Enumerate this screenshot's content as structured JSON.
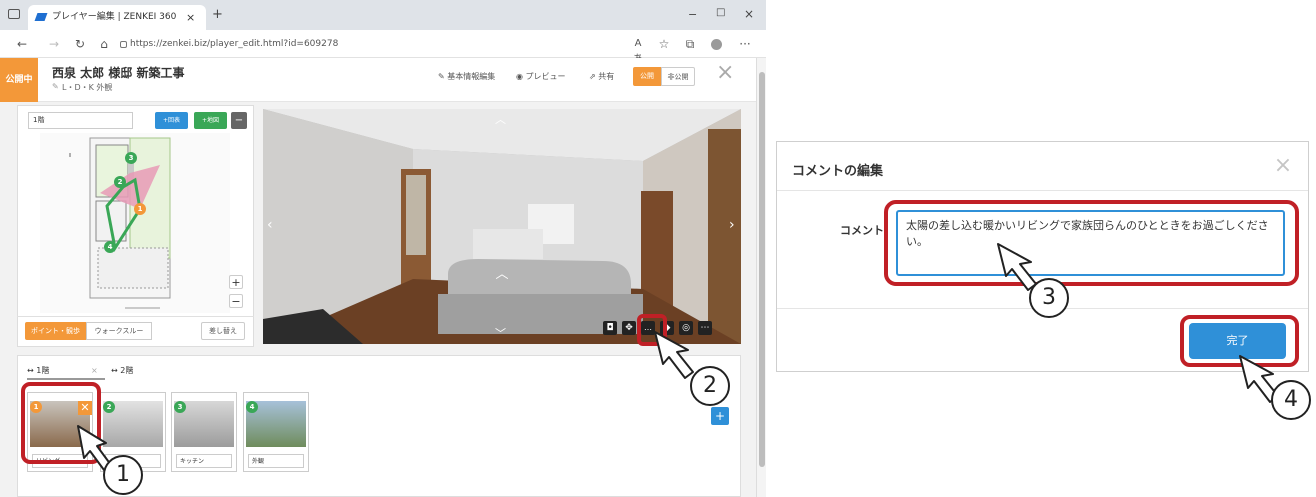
{
  "browser": {
    "tab_title": "プレイヤー編集 | ZENKEI 360",
    "tab_close": "×",
    "new_tab": "+",
    "url": "https://zenkei.biz/player_edit.html?id=609278",
    "win_controls": [
      "−",
      "□",
      "×"
    ]
  },
  "header": {
    "status_badge": "公開中",
    "title": "西泉 太郎 様邸 新築工事",
    "subtitle": "L・D・K 外観",
    "links": [
      "基本情報編集",
      "プレビュー",
      "共有"
    ],
    "publish_on": "公開",
    "publish_off": "非公開",
    "close": "×"
  },
  "map": {
    "floor_value": "1階",
    "add_floorplan": "+回表",
    "add_map": "+地図",
    "remove": "−",
    "zoom_in": "+",
    "zoom_out": "−",
    "mode_point": "ポイント・観歩",
    "mode_walk": "ウォークスルー",
    "replace": "差し替え",
    "points": [
      "1",
      "2",
      "3",
      "4"
    ]
  },
  "floor_tabs": [
    "1階",
    "2階"
  ],
  "scenes": [
    {
      "num": "1",
      "name": "リビング",
      "color": "#f39839"
    },
    {
      "num": "2",
      "name": "",
      "color": "#3aa757"
    },
    {
      "num": "3",
      "name": "キッチン",
      "color": "#3aa757"
    },
    {
      "num": "4",
      "name": "外観",
      "color": "#3aa757"
    }
  ],
  "add_scene": "+",
  "modal": {
    "title": "コメントの編集",
    "close": "×",
    "label": "コメント",
    "text": "太陽の差し込む暖かいリビングで家族団らんのひとときをお過ごしください。",
    "done": "完了"
  },
  "callouts": [
    "1",
    "2",
    "3",
    "4"
  ],
  "colors": {
    "accent": "#2f90d8",
    "highlight": "#c02026",
    "published": "#f39839",
    "green": "#3aa757"
  }
}
